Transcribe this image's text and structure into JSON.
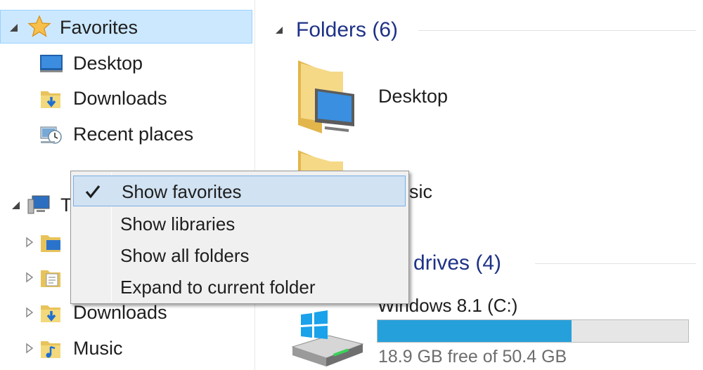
{
  "nav": {
    "favorites": {
      "label": "Favorites",
      "items": [
        {
          "label": "Desktop",
          "icon": "desktop-icon"
        },
        {
          "label": "Downloads",
          "icon": "downloads-folder-icon"
        },
        {
          "label": "Recent places",
          "icon": "recent-places-icon"
        }
      ]
    },
    "this_pc": {
      "label_visible": "T",
      "items": [
        {
          "label": "",
          "icon": "desktop-folder-icon"
        },
        {
          "label": "",
          "icon": "documents-folder-icon"
        },
        {
          "label": "Downloads",
          "icon": "downloads-folder-icon"
        },
        {
          "label": "Music",
          "icon": "music-folder-icon"
        }
      ]
    }
  },
  "content": {
    "folders_header": "Folders (6)",
    "folders": [
      {
        "label": "Desktop",
        "icon": "desktop-folder-icon"
      },
      {
        "label": "sic",
        "icon": "music-folder-icon"
      }
    ],
    "drives_header": "d drives (4)",
    "drive": {
      "name": "Windows 8.1 (C:)",
      "free_text": "18.9 GB free of 50.4 GB",
      "used_fraction": 0.625,
      "bar_color": "#26a0da"
    }
  },
  "context_menu": {
    "items": [
      {
        "label": "Show favorites",
        "checked": true
      },
      {
        "label": "Show libraries",
        "checked": false
      },
      {
        "label": "Show all folders",
        "checked": false
      },
      {
        "label": "Expand to current folder",
        "checked": false
      }
    ]
  },
  "colors": {
    "selection_bg": "#cce8ff",
    "group_header": "#1e3287",
    "menu_highlight": "#d1e2f2"
  }
}
